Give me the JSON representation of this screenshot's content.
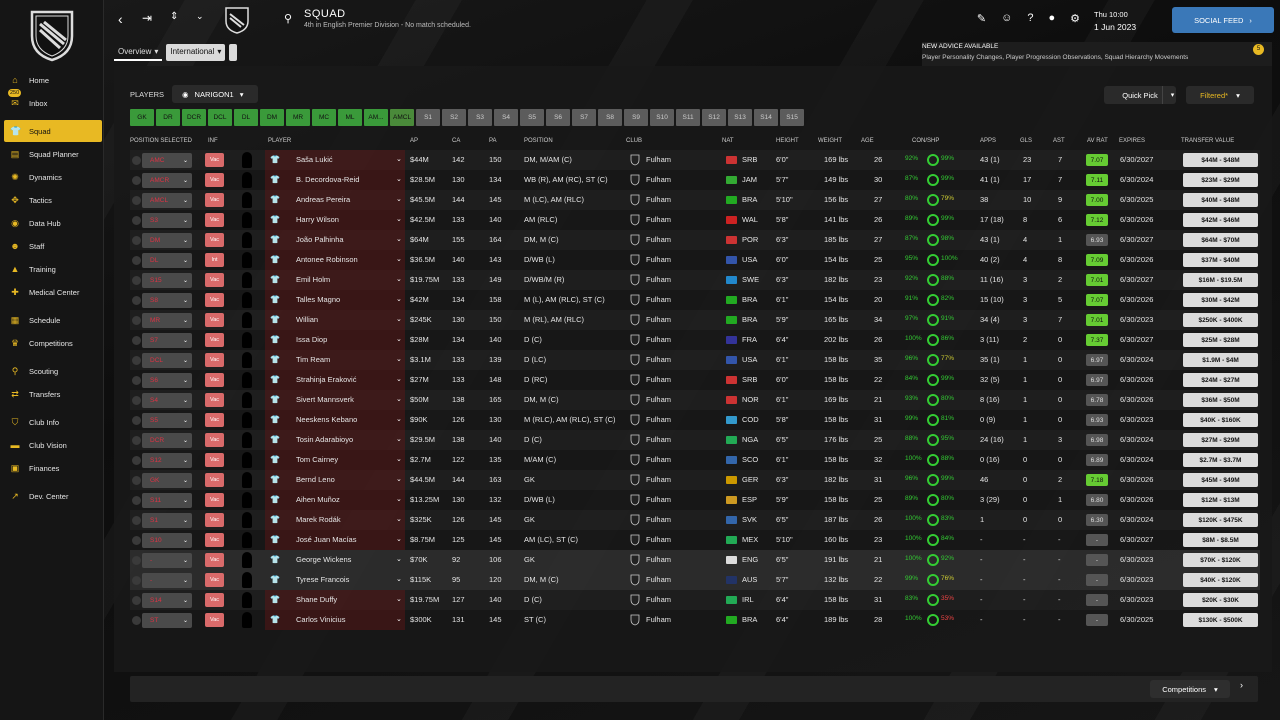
{
  "sidebar": {
    "items": [
      {
        "label": "Home",
        "icon": "home-icon",
        "glyph": "⌂"
      },
      {
        "label": "Inbox",
        "icon": "inbox-icon",
        "glyph": "✉",
        "badge": "250"
      },
      {
        "label": "Squad",
        "icon": "squad-icon",
        "glyph": "👕",
        "active": true
      },
      {
        "label": "Squad Planner",
        "icon": "planner-icon",
        "glyph": "▤"
      },
      {
        "label": "Dynamics",
        "icon": "dynamics-icon",
        "glyph": "✺"
      },
      {
        "label": "Tactics",
        "icon": "tactics-icon",
        "glyph": "✥"
      },
      {
        "label": "Data Hub",
        "icon": "data-hub-icon",
        "glyph": "◉"
      },
      {
        "label": "Staff",
        "icon": "staff-icon",
        "glyph": "☻"
      },
      {
        "label": "Training",
        "icon": "training-icon",
        "glyph": "▲"
      },
      {
        "label": "Medical Center",
        "icon": "medical-icon",
        "glyph": "✚"
      },
      {
        "label": "Schedule",
        "icon": "schedule-icon",
        "glyph": "▦"
      },
      {
        "label": "Competitions",
        "icon": "trophy-icon",
        "glyph": "♛"
      },
      {
        "label": "Scouting",
        "icon": "scouting-icon",
        "glyph": "⚲"
      },
      {
        "label": "Transfers",
        "icon": "transfers-icon",
        "glyph": "⇄"
      },
      {
        "label": "Club Info",
        "icon": "club-info-icon",
        "glyph": "⛉"
      },
      {
        "label": "Club Vision",
        "icon": "club-vision-icon",
        "glyph": "▬"
      },
      {
        "label": "Finances",
        "icon": "finances-icon",
        "glyph": "▣"
      },
      {
        "label": "Dev. Center",
        "icon": "dev-center-icon",
        "glyph": "↗"
      }
    ]
  },
  "header": {
    "title": "SQUAD",
    "subtitle": "4th in English Premier Division - No match scheduled.",
    "time": "Thu 10:00",
    "date": "1 Jun 2023",
    "social_feed": "SOCIAL FEED"
  },
  "advice": {
    "title": "NEW ADVICE AVAILABLE",
    "body": "Player Personality Changes, Player Progression Observations, Squad Hierarchy Movements",
    "count": "5"
  },
  "subtabs": {
    "overview": "Overview",
    "international": "International"
  },
  "controls": {
    "players_label": "PLAYERS",
    "view": "NARIGON1",
    "quick_pick": "Quick Pick",
    "filtered": "Filtered*",
    "position_filters": [
      "GK",
      "DR",
      "DCR",
      "DCL",
      "DL",
      "DM",
      "MR",
      "MC",
      "ML",
      "AM...",
      "AMCL",
      "S1",
      "S2",
      "S3",
      "S4",
      "S5",
      "S6",
      "S7",
      "S8",
      "S9",
      "S10",
      "S11",
      "S12",
      "S13",
      "S14",
      "S15"
    ]
  },
  "columns": {
    "position": "POSITION SELECTED",
    "inf": "INF",
    "player": "PLAYER",
    "ap": "AP",
    "ca": "CA",
    "pa": "PA",
    "pos": "POSITION",
    "club": "CLUB",
    "nat": "NAT",
    "height": "HEIGHT",
    "weight": "WEIGHT",
    "age": "AGE",
    "conshp": "CON/SHP",
    "apps": "APPS",
    "gls": "GLS",
    "ast": "AST",
    "avrat": "AV RAT",
    "expires": "EXPIRES",
    "tv": "TRANSFER VALUE"
  },
  "players": [
    {
      "sel": "AMC",
      "sc": "#d33",
      "inf": "Vac",
      "name": "Saša Lukić",
      "ap": "$44M",
      "ca": "142",
      "pa": "150",
      "pos": "DM, M/AM (C)",
      "club": "Fulham",
      "nat": "SRB",
      "fc": "#c33",
      "h": "6'0\"",
      "w": "169 lbs",
      "age": "26",
      "con": "92%",
      "shp": "99%",
      "apps": "43 (1)",
      "gls": "23",
      "ast": "7",
      "av": "7.07",
      "avc": "#6c3",
      "exp": "6/30/2027",
      "tv": "$44M - $48M"
    },
    {
      "sel": "AMCR",
      "sc": "#d33",
      "inf": "Vac",
      "name": "B. Decordova-Reid",
      "ap": "$28.5M",
      "ca": "130",
      "pa": "134",
      "pos": "WB (R), AM (RC), ST (C)",
      "club": "Fulham",
      "nat": "JAM",
      "fc": "#3a3",
      "h": "5'7\"",
      "w": "149 lbs",
      "age": "30",
      "con": "87%",
      "shp": "99%",
      "apps": "41 (1)",
      "gls": "17",
      "ast": "7",
      "av": "7.11",
      "avc": "#6c3",
      "exp": "6/30/2024",
      "tv": "$23M - $29M"
    },
    {
      "sel": "AMCL",
      "sc": "#d33",
      "inf": "Vac",
      "name": "Andreas Pereira",
      "ap": "$45.5M",
      "ca": "144",
      "pa": "145",
      "pos": "M (LC), AM (RLC)",
      "club": "Fulham",
      "nat": "BRA",
      "fc": "#2a2",
      "h": "5'10\"",
      "w": "156 lbs",
      "age": "27",
      "con": "80%",
      "shp": "79%",
      "apps": "38",
      "gls": "10",
      "ast": "9",
      "av": "7.00",
      "avc": "#6c3",
      "exp": "6/30/2025",
      "tv": "$40M - $48M"
    },
    {
      "sel": "S3",
      "sc": "#d33",
      "inf": "Vac",
      "name": "Harry Wilson",
      "ap": "$42.5M",
      "ca": "133",
      "pa": "140",
      "pos": "AM (RLC)",
      "club": "Fulham",
      "nat": "WAL",
      "fc": "#c22",
      "h": "5'8\"",
      "w": "141 lbs",
      "age": "26",
      "con": "89%",
      "shp": "99%",
      "apps": "17 (18)",
      "gls": "8",
      "ast": "6",
      "av": "7.12",
      "avc": "#6c3",
      "exp": "6/30/2026",
      "tv": "$42M - $46M"
    },
    {
      "sel": "DM",
      "sc": "#d33",
      "inf": "Vac",
      "name": "João Palhinha",
      "ap": "$64M",
      "ca": "155",
      "pa": "164",
      "pos": "DM, M (C)",
      "club": "Fulham",
      "nat": "POR",
      "fc": "#c33",
      "h": "6'3\"",
      "w": "185 lbs",
      "age": "27",
      "con": "87%",
      "shp": "98%",
      "apps": "43 (1)",
      "gls": "4",
      "ast": "1",
      "av": "6.93",
      "avc": "#555",
      "exp": "6/30/2027",
      "tv": "$64M - $70M"
    },
    {
      "sel": "DL",
      "sc": "#d33",
      "inf": "Int",
      "name": "Antonee Robinson",
      "ap": "$36.5M",
      "ca": "140",
      "pa": "143",
      "pos": "D/WB (L)",
      "club": "Fulham",
      "nat": "USA",
      "fc": "#35a",
      "h": "6'0\"",
      "w": "154 lbs",
      "age": "25",
      "con": "95%",
      "shp": "100%",
      "apps": "40 (2)",
      "gls": "4",
      "ast": "8",
      "av": "7.09",
      "avc": "#6c3",
      "exp": "6/30/2026",
      "tv": "$37M - $40M"
    },
    {
      "sel": "S15",
      "sc": "#d33",
      "inf": "Vac",
      "name": "Emil Holm",
      "ap": "$19.75M",
      "ca": "133",
      "pa": "149",
      "pos": "D/WB/M (R)",
      "club": "Fulham",
      "nat": "SWE",
      "fc": "#28c",
      "h": "6'3\"",
      "w": "182 lbs",
      "age": "23",
      "con": "92%",
      "shp": "88%",
      "apps": "11 (16)",
      "gls": "3",
      "ast": "2",
      "av": "7.01",
      "avc": "#6c3",
      "exp": "6/30/2027",
      "tv": "$16M - $19.5M"
    },
    {
      "sel": "S8",
      "sc": "#d33",
      "inf": "Vac",
      "name": "Talles Magno",
      "ap": "$42M",
      "ca": "134",
      "pa": "158",
      "pos": "M (L), AM (RLC), ST (C)",
      "club": "Fulham",
      "nat": "BRA",
      "fc": "#2a2",
      "h": "6'1\"",
      "w": "154 lbs",
      "age": "20",
      "con": "91%",
      "shp": "82%",
      "apps": "15 (10)",
      "gls": "3",
      "ast": "5",
      "av": "7.07",
      "avc": "#6c3",
      "exp": "6/30/2026",
      "tv": "$30M - $42M"
    },
    {
      "sel": "MR",
      "sc": "#d33",
      "inf": "Vac",
      "name": "Willian",
      "ap": "$245K",
      "ca": "130",
      "pa": "150",
      "pos": "M (RL), AM (RLC)",
      "club": "Fulham",
      "nat": "BRA",
      "fc": "#2a2",
      "h": "5'9\"",
      "w": "165 lbs",
      "age": "34",
      "con": "97%",
      "shp": "91%",
      "apps": "34 (4)",
      "gls": "3",
      "ast": "7",
      "av": "7.01",
      "avc": "#6c3",
      "exp": "6/30/2023",
      "tv": "$250K - $400K"
    },
    {
      "sel": "S7",
      "sc": "#d33",
      "inf": "Vac",
      "name": "Issa Diop",
      "ap": "$28M",
      "ca": "134",
      "pa": "140",
      "pos": "D (C)",
      "club": "Fulham",
      "nat": "FRA",
      "fc": "#339",
      "h": "6'4\"",
      "w": "202 lbs",
      "age": "26",
      "con": "100%",
      "shp": "86%",
      "apps": "3 (11)",
      "gls": "2",
      "ast": "0",
      "av": "7.37",
      "avc": "#6c3",
      "exp": "6/30/2027",
      "tv": "$25M - $28M"
    },
    {
      "sel": "DCL",
      "sc": "#d33",
      "inf": "Vac",
      "name": "Tim Ream",
      "ap": "$3.1M",
      "ca": "133",
      "pa": "139",
      "pos": "D (LC)",
      "club": "Fulham",
      "nat": "USA",
      "fc": "#35a",
      "h": "6'1\"",
      "w": "158 lbs",
      "age": "35",
      "con": "96%",
      "shp": "77%",
      "apps": "35 (1)",
      "gls": "1",
      "ast": "0",
      "av": "6.97",
      "avc": "#555",
      "exp": "6/30/2024",
      "tv": "$1.9M - $4M"
    },
    {
      "sel": "S6",
      "sc": "#d33",
      "inf": "Vac",
      "name": "Strahinja Eraković",
      "ap": "$27M",
      "ca": "133",
      "pa": "148",
      "pos": "D (RC)",
      "club": "Fulham",
      "nat": "SRB",
      "fc": "#c33",
      "h": "6'0\"",
      "w": "158 lbs",
      "age": "22",
      "con": "84%",
      "shp": "99%",
      "apps": "32 (5)",
      "gls": "1",
      "ast": "0",
      "av": "6.97",
      "avc": "#555",
      "exp": "6/30/2026",
      "tv": "$24M - $27M"
    },
    {
      "sel": "S4",
      "sc": "#d33",
      "inf": "Vac",
      "name": "Sivert Mannsverk",
      "ap": "$50M",
      "ca": "138",
      "pa": "165",
      "pos": "DM, M (C)",
      "club": "Fulham",
      "nat": "NOR",
      "fc": "#c33",
      "h": "6'1\"",
      "w": "169 lbs",
      "age": "21",
      "con": "93%",
      "shp": "80%",
      "apps": "8 (16)",
      "gls": "1",
      "ast": "0",
      "av": "6.78",
      "avc": "#555",
      "exp": "6/30/2026",
      "tv": "$36M - $50M"
    },
    {
      "sel": "S5",
      "sc": "#d33",
      "inf": "Vac",
      "name": "Neeskens Kebano",
      "ap": "$90K",
      "ca": "126",
      "pa": "130",
      "pos": "M (RLC), AM (RLC), ST (C)",
      "club": "Fulham",
      "nat": "COD",
      "fc": "#39c",
      "h": "5'8\"",
      "w": "158 lbs",
      "age": "31",
      "con": "99%",
      "shp": "81%",
      "apps": "0 (9)",
      "gls": "1",
      "ast": "0",
      "av": "6.93",
      "avc": "#555",
      "exp": "6/30/2023",
      "tv": "$40K - $160K"
    },
    {
      "sel": "DCR",
      "sc": "#d33",
      "inf": "Vac",
      "name": "Tosin Adarabioyo",
      "ap": "$29.5M",
      "ca": "138",
      "pa": "140",
      "pos": "D (C)",
      "club": "Fulham",
      "nat": "NGA",
      "fc": "#2a5",
      "h": "6'5\"",
      "w": "176 lbs",
      "age": "25",
      "con": "88%",
      "shp": "95%",
      "apps": "24 (16)",
      "gls": "1",
      "ast": "3",
      "av": "6.98",
      "avc": "#555",
      "exp": "6/30/2024",
      "tv": "$27M - $29M"
    },
    {
      "sel": "S12",
      "sc": "#d33",
      "inf": "Vac",
      "name": "Tom Cairney",
      "ap": "$2.7M",
      "ca": "122",
      "pa": "135",
      "pos": "M/AM (C)",
      "club": "Fulham",
      "nat": "SCO",
      "fc": "#36a",
      "h": "6'1\"",
      "w": "158 lbs",
      "age": "32",
      "con": "100%",
      "shp": "88%",
      "apps": "0 (16)",
      "gls": "0",
      "ast": "0",
      "av": "6.89",
      "avc": "#555",
      "exp": "6/30/2024",
      "tv": "$2.7M - $3.7M"
    },
    {
      "sel": "GK",
      "sc": "#d33",
      "inf": "Vac",
      "name": "Bernd Leno",
      "ap": "$44.5M",
      "ca": "144",
      "pa": "163",
      "pos": "GK",
      "club": "Fulham",
      "nat": "GER",
      "fc": "#c90",
      "h": "6'3\"",
      "w": "182 lbs",
      "age": "31",
      "con": "96%",
      "shp": "99%",
      "apps": "46",
      "gls": "0",
      "ast": "2",
      "av": "7.18",
      "avc": "#6c3",
      "exp": "6/30/2026",
      "tv": "$45M - $49M"
    },
    {
      "sel": "S11",
      "sc": "#d33",
      "inf": "Vac",
      "name": "Aihen Muñoz",
      "ap": "$13.25M",
      "ca": "130",
      "pa": "132",
      "pos": "D/WB (L)",
      "club": "Fulham",
      "nat": "ESP",
      "fc": "#c92",
      "h": "5'9\"",
      "w": "158 lbs",
      "age": "25",
      "con": "89%",
      "shp": "80%",
      "apps": "3 (29)",
      "gls": "0",
      "ast": "1",
      "av": "6.80",
      "avc": "#555",
      "exp": "6/30/2026",
      "tv": "$12M - $13M"
    },
    {
      "sel": "S1",
      "sc": "#d33",
      "inf": "Vac",
      "name": "Marek Rodák",
      "ap": "$325K",
      "ca": "126",
      "pa": "145",
      "pos": "GK",
      "club": "Fulham",
      "nat": "SVK",
      "fc": "#36a",
      "h": "6'5\"",
      "w": "187 lbs",
      "age": "26",
      "con": "100%",
      "shp": "83%",
      "apps": "1",
      "gls": "0",
      "ast": "0",
      "av": "6.30",
      "avc": "#555",
      "exp": "6/30/2024",
      "tv": "$120K - $475K"
    },
    {
      "sel": "S10",
      "sc": "#d33",
      "inf": "Vac",
      "name": "José Juan Macías",
      "ap": "$8.75M",
      "ca": "125",
      "pa": "145",
      "pos": "AM (LC), ST (C)",
      "club": "Fulham",
      "nat": "MEX",
      "fc": "#2a5",
      "h": "5'10\"",
      "w": "160 lbs",
      "age": "23",
      "con": "100%",
      "shp": "84%",
      "apps": "-",
      "gls": "-",
      "ast": "-",
      "av": "-",
      "avc": "#555",
      "exp": "6/30/2027",
      "tv": "$8M - $8.5M"
    },
    {
      "sel": "-",
      "sc": "#d33",
      "inf": "Vac",
      "name": "George Wickens",
      "ap": "$70K",
      "ca": "92",
      "pa": "106",
      "pos": "GK",
      "club": "Fulham",
      "nat": "ENG",
      "fc": "#ddd",
      "h": "6'5\"",
      "w": "191 lbs",
      "age": "21",
      "con": "100%",
      "shp": "92%",
      "apps": "-",
      "gls": "-",
      "ast": "-",
      "av": "-",
      "avc": "#555",
      "exp": "6/30/2023",
      "tv": "$70K - $120K",
      "lite": true
    },
    {
      "sel": "-",
      "sc": "#d33",
      "inf": "Vac",
      "name": "Tyrese Francois",
      "ap": "$115K",
      "ca": "95",
      "pa": "120",
      "pos": "DM, M (C)",
      "club": "Fulham",
      "nat": "AUS",
      "fc": "#236",
      "h": "5'7\"",
      "w": "132 lbs",
      "age": "22",
      "con": "99%",
      "shp": "76%",
      "apps": "-",
      "gls": "-",
      "ast": "-",
      "av": "-",
      "avc": "#555",
      "exp": "6/30/2023",
      "tv": "$40K - $120K",
      "lite": true
    },
    {
      "sel": "S14",
      "sc": "#d33",
      "inf": "Vac",
      "name": "Shane Duffy",
      "ap": "$19.75M",
      "ca": "127",
      "pa": "140",
      "pos": "D (C)",
      "club": "Fulham",
      "nat": "IRL",
      "fc": "#2a5",
      "h": "6'4\"",
      "w": "158 lbs",
      "age": "31",
      "con": "83%",
      "shp": "35%",
      "apps": "-",
      "gls": "-",
      "ast": "-",
      "av": "-",
      "avc": "#555",
      "exp": "6/30/2023",
      "tv": "$20K - $30K"
    },
    {
      "sel": "ST",
      "sc": "#d33",
      "inf": "Vac",
      "name": "Carlos Vinicius",
      "ap": "$300K",
      "ca": "131",
      "pa": "145",
      "pos": "ST (C)",
      "club": "Fulham",
      "nat": "BRA",
      "fc": "#2a2",
      "h": "6'4\"",
      "w": "189 lbs",
      "age": "28",
      "con": "100%",
      "shp": "53%",
      "apps": "-",
      "gls": "-",
      "ast": "-",
      "av": "-",
      "avc": "#555",
      "exp": "6/30/2025",
      "tv": "$130K - $500K"
    }
  ],
  "footer": {
    "competitions": "Competitions"
  }
}
